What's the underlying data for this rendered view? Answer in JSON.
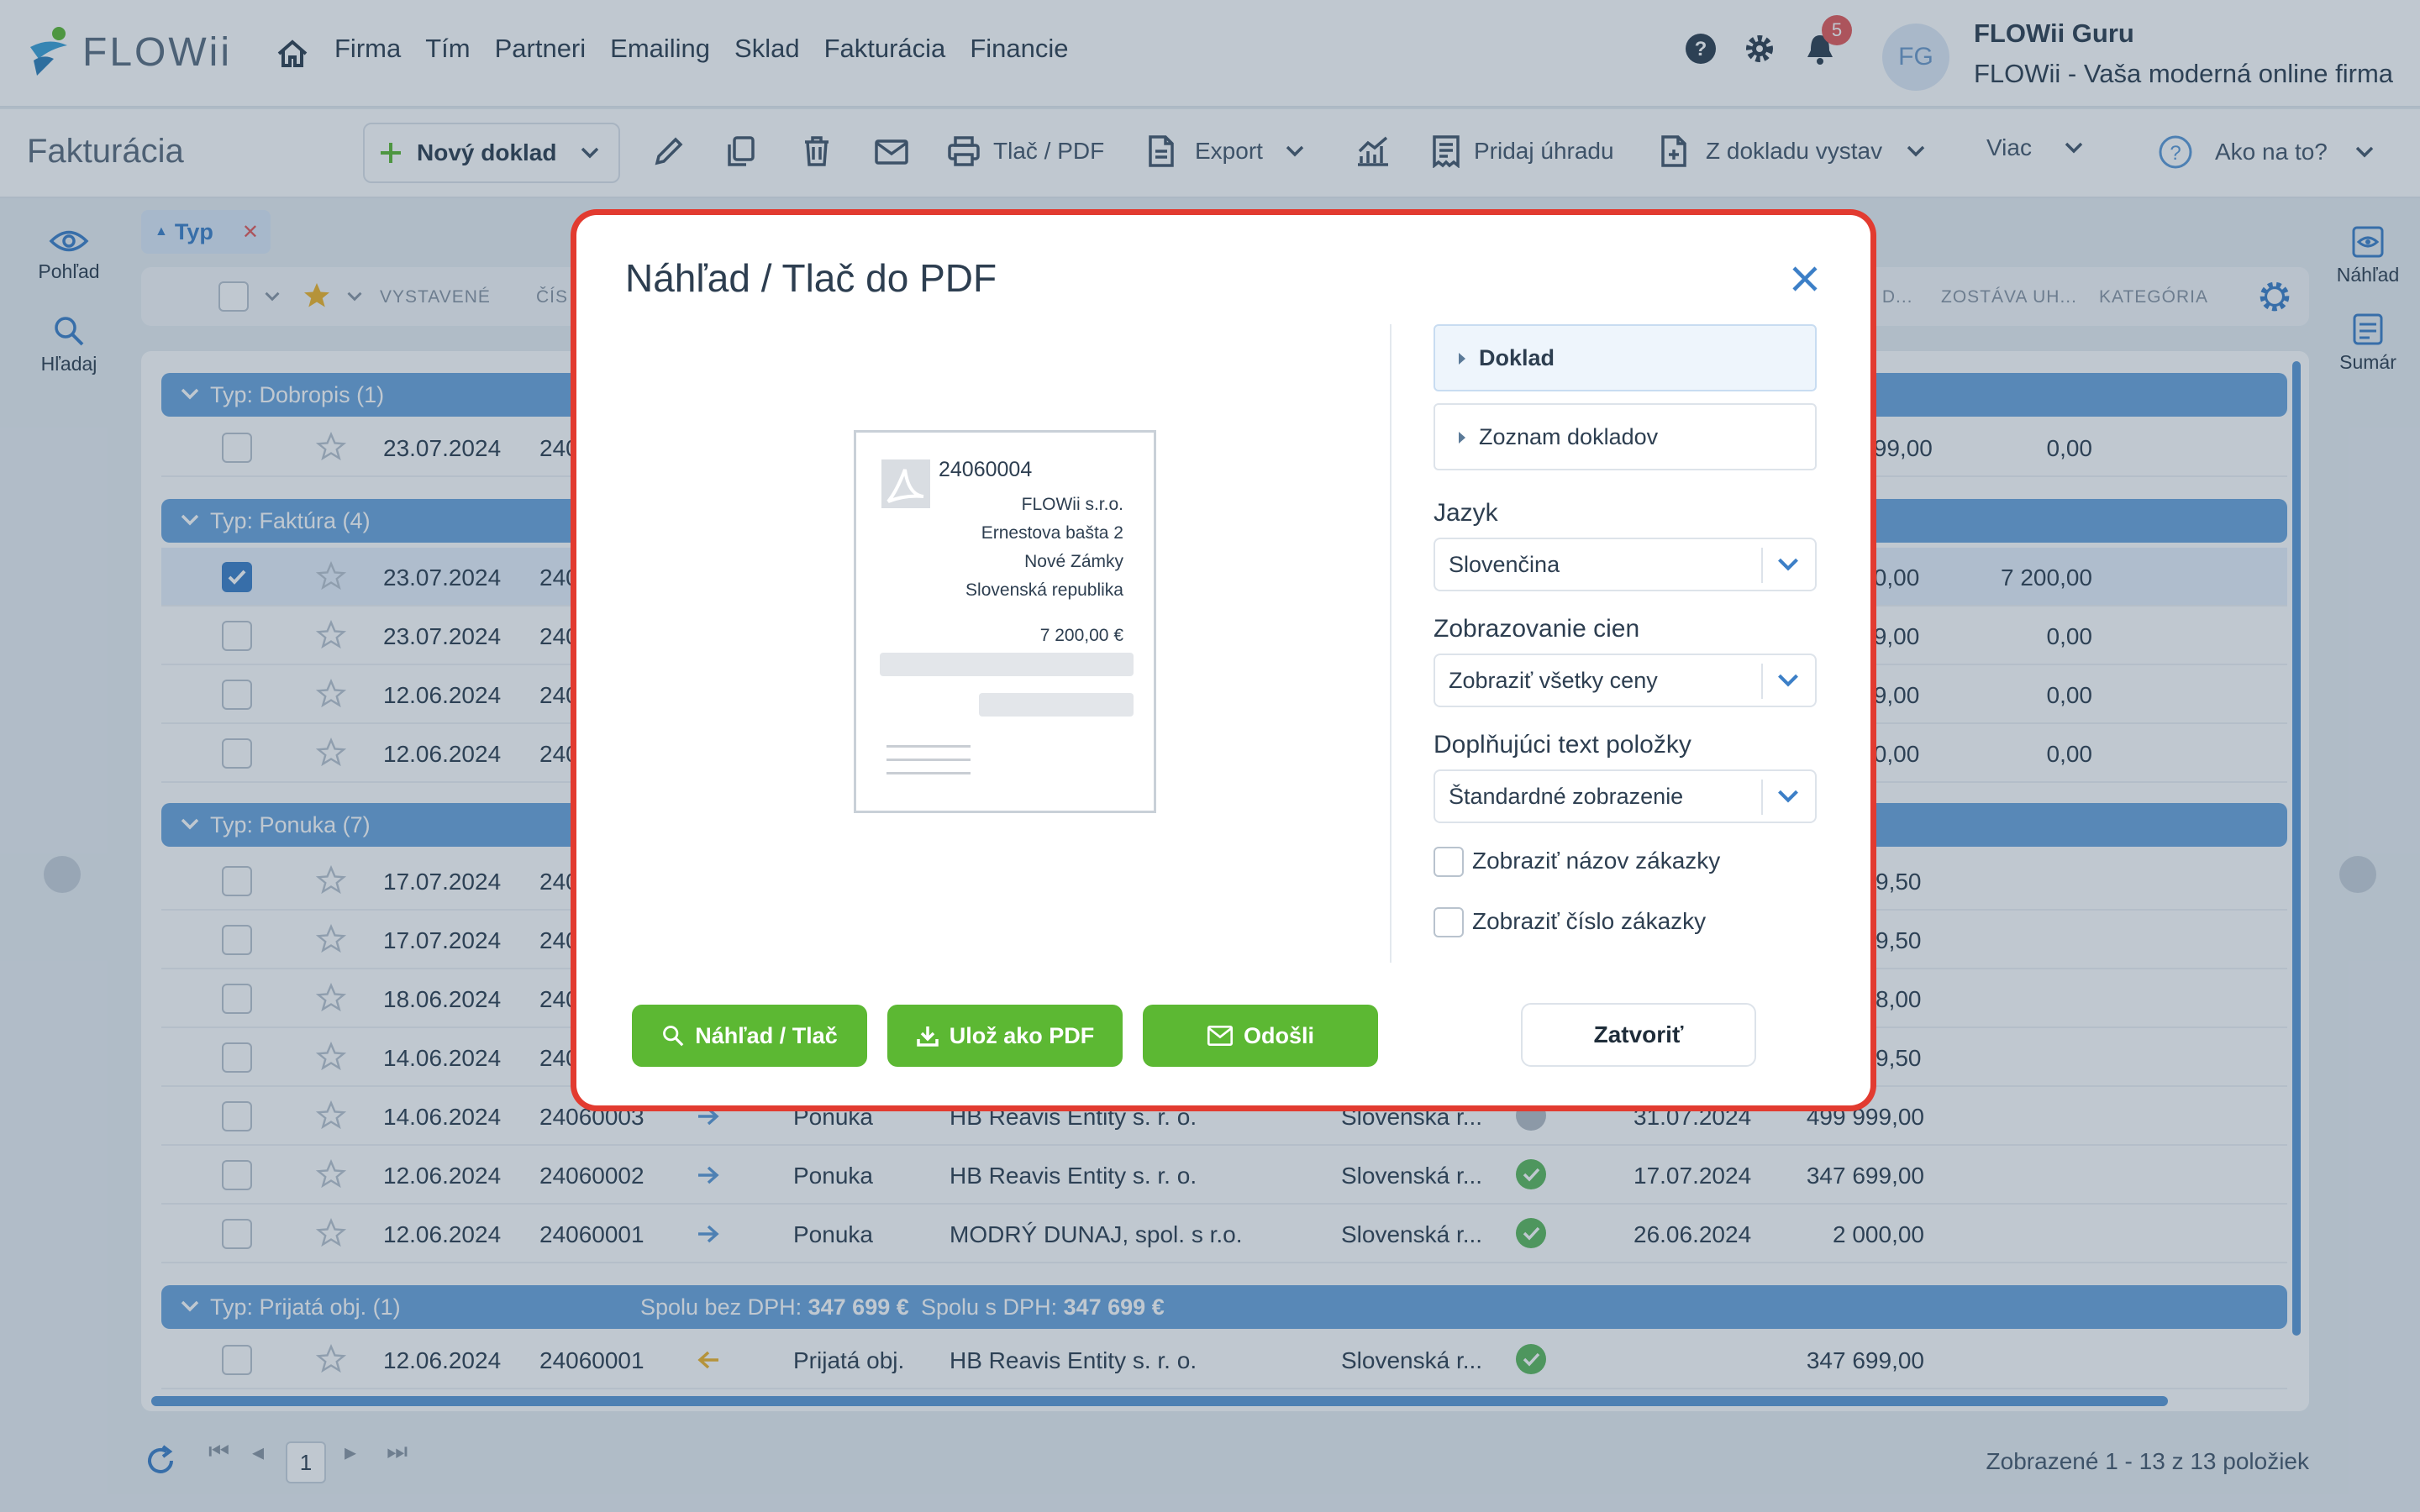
{
  "app": {
    "logo_text": "FLOWii",
    "nav": [
      "Firma",
      "Tím",
      "Partneri",
      "Emailing",
      "Sklad",
      "Fakturácia",
      "Financie"
    ],
    "notifications_count": "5",
    "avatar_initials": "FG",
    "user_name": "FLOWii Guru",
    "user_org": "FLOWii - Vaša moderná online firma"
  },
  "toolbar": {
    "page_title": "Fakturácia",
    "new_doc": "Nový doklad",
    "print_pdf": "Tlač / PDF",
    "export": "Export",
    "add_payment": "Pridaj úhradu",
    "from_doc": "Z dokladu vystav",
    "more": "Viac",
    "help": "Ako na to?"
  },
  "rail": {
    "view": "Pohľad",
    "search": "Hľadaj",
    "preview": "Náhľad",
    "summary": "Sumár"
  },
  "filter": {
    "label": "Typ"
  },
  "table": {
    "headers": {
      "issued": "VYSTAVENÉ",
      "number": "ČÍS",
      "due": "S D...",
      "remaining": "ZOSTÁVA UH...",
      "category": "KATEGÓRIA"
    },
    "groups": [
      {
        "label": "Typ: Dobropis (1)"
      },
      {
        "label": "Typ: Faktúra (4)"
      },
      {
        "label": "Typ: Ponuka (7)"
      },
      {
        "label": "Typ: Prijatá obj. (1)",
        "sum_net_label": "Spolu bez DPH:",
        "sum_net": "347 699 €",
        "sum_gross_label": "Spolu s DPH:",
        "sum_gross": "347 699 €"
      }
    ],
    "rows": [
      {
        "date": "23.07.2024",
        "num": "240",
        "amount": ",99,00",
        "remaining": "0,00"
      },
      {
        "date": "23.07.2024",
        "num": "240",
        "amount": ",0,00",
        "remaining": "7 200,00"
      },
      {
        "date": "23.07.2024",
        "num": "240",
        "amount": ",9,00",
        "remaining": "0,00"
      },
      {
        "date": "12.06.2024",
        "num": "240",
        "amount": ",9,00",
        "remaining": "0,00"
      },
      {
        "date": "12.06.2024",
        "num": "240",
        "amount": ",0,00",
        "remaining": "0,00"
      },
      {
        "date": "17.07.2024",
        "num": "240",
        "amount": "9,50"
      },
      {
        "date": "17.07.2024",
        "num": "240",
        "amount": "9,50"
      },
      {
        "date": "18.06.2024",
        "num": "240",
        "amount": "8,00"
      },
      {
        "date": "14.06.2024",
        "num": "240",
        "amount": "9,50"
      },
      {
        "date": "14.06.2024",
        "num": "24060003",
        "type": "Ponuka",
        "partner": "HB Reavis Entity s. r. o.",
        "country": "Slovenská r...",
        "due": "31.07.2024",
        "amount": "499 999,00"
      },
      {
        "date": "12.06.2024",
        "num": "24060002",
        "type": "Ponuka",
        "partner": "HB Reavis Entity s. r. o.",
        "country": "Slovenská r...",
        "due": "17.07.2024",
        "amount": "347 699,00"
      },
      {
        "date": "12.06.2024",
        "num": "24060001",
        "type": "Ponuka",
        "partner": "MODRÝ DUNAJ, spol. s r.o.",
        "country": "Slovenská r...",
        "due": "26.06.2024",
        "amount": "2 000,00"
      },
      {
        "date": "12.06.2024",
        "num": "24060001",
        "type": "Prijatá obj.",
        "partner": "HB Reavis Entity s. r. o.",
        "country": "Slovenská r...",
        "amount": "347 699,00"
      }
    ]
  },
  "pager": {
    "page": "1",
    "count": "Zobrazené 1 - 13 z 13 položiek"
  },
  "modal": {
    "title": "Náhľad / Tlač do PDF",
    "preview": {
      "number": "24060004",
      "company": "FLOWii s.r.o.",
      "street": "Ernestova bašta 2",
      "city": "Nové Zámky",
      "country": "Slovenská republika",
      "total": "7 200,00 €"
    },
    "tabs": {
      "doc": "Doklad",
      "list": "Zoznam dokladov"
    },
    "language": {
      "label": "Jazyk",
      "value": "Slovenčina"
    },
    "prices": {
      "label": "Zobrazovanie cien",
      "value": "Zobraziť všetky ceny"
    },
    "item_text": {
      "label": "Doplňujúci text položky",
      "value": "Štandardné zobrazenie"
    },
    "check_order_name": "Zobraziť názov zákazky",
    "check_order_num": "Zobraziť číslo zákazky",
    "btn_preview": "Náhľad / Tlač",
    "btn_save_pdf": "Ulož ako PDF",
    "btn_send": "Odošli",
    "btn_close": "Zatvoriť"
  },
  "colors": {
    "accent": "#5cb833",
    "primary": "#3c7fc7",
    "highlight": "#e23b30",
    "group": "#6aa4dc"
  }
}
